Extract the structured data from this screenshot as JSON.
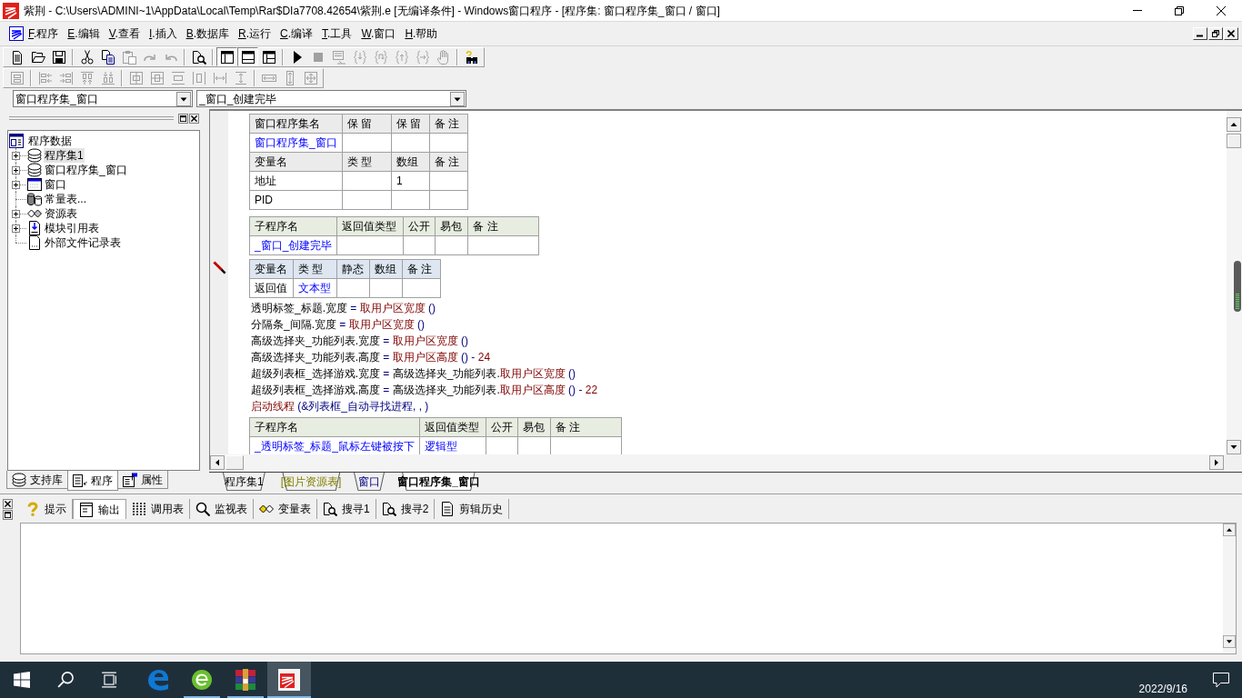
{
  "window": {
    "title": "紫荆 - C:\\Users\\ADMINI~1\\AppData\\Local\\Temp\\Rar$DIa7708.42654\\紫荆.e [无编译条件] - Windows窗口程序 - [程序集: 窗口程序集_窗口 / 窗口]"
  },
  "menu": [
    "F.程序",
    "E.编辑",
    "V.查看",
    "I.插入",
    "B.数据库",
    "R.运行",
    "C.编译",
    "T.工具",
    "W.窗口",
    "H.帮助"
  ],
  "toolbars": [
    {
      "groups": [
        [
          {
            "kind": "new",
            "disabled": false,
            "pressed": false
          },
          {
            "kind": "open",
            "disabled": false,
            "pressed": false
          },
          {
            "kind": "save",
            "disabled": false,
            "pressed": false
          }
        ],
        [
          {
            "kind": "cut",
            "disabled": false,
            "pressed": false
          },
          {
            "kind": "copy",
            "disabled": false,
            "pressed": false
          },
          {
            "kind": "paste",
            "disabled": true,
            "pressed": false
          },
          {
            "kind": "redo",
            "disabled": true,
            "pressed": false
          },
          {
            "kind": "undo",
            "disabled": true,
            "pressed": false
          }
        ],
        [
          {
            "kind": "find",
            "disabled": false,
            "pressed": false
          }
        ],
        [
          {
            "kind": "layout-left",
            "disabled": false,
            "pressed": true
          },
          {
            "kind": "layout-bottom",
            "disabled": false,
            "pressed": true
          },
          {
            "kind": "layout-grid",
            "disabled": false,
            "pressed": false
          }
        ],
        [
          {
            "kind": "run",
            "disabled": false,
            "pressed": false
          },
          {
            "kind": "stop",
            "disabled": true,
            "pressed": false
          },
          {
            "kind": "debug-window",
            "disabled": true,
            "pressed": false
          },
          {
            "kind": "step-into",
            "disabled": true,
            "pressed": false
          },
          {
            "kind": "step-over",
            "disabled": true,
            "pressed": false
          },
          {
            "kind": "step-out",
            "disabled": true,
            "pressed": false
          },
          {
            "kind": "run-to",
            "disabled": true,
            "pressed": false
          },
          {
            "kind": "hand",
            "disabled": true,
            "pressed": false
          }
        ],
        [
          {
            "kind": "help-search",
            "disabled": false,
            "pressed": false
          }
        ]
      ]
    },
    {
      "groups": [
        [
          {
            "kind": "form",
            "disabled": true,
            "pressed": false
          }
        ],
        [
          {
            "kind": "align-left",
            "disabled": true,
            "pressed": false
          },
          {
            "kind": "align-right",
            "disabled": true,
            "pressed": false
          },
          {
            "kind": "align-top",
            "disabled": true,
            "pressed": false
          },
          {
            "kind": "align-bottom",
            "disabled": true,
            "pressed": false
          }
        ],
        [
          {
            "kind": "center-horizontal",
            "disabled": true,
            "pressed": false
          },
          {
            "kind": "center-vertical",
            "disabled": true,
            "pressed": false
          },
          {
            "kind": "space-vertical",
            "disabled": true,
            "pressed": false
          },
          {
            "kind": "space-horizontal",
            "disabled": true,
            "pressed": false
          },
          {
            "kind": "spread-horizontal",
            "disabled": true,
            "pressed": false
          },
          {
            "kind": "spread-vertical",
            "disabled": true,
            "pressed": false
          }
        ],
        [
          {
            "kind": "same-width",
            "disabled": true,
            "pressed": false
          },
          {
            "kind": "same-height",
            "disabled": true,
            "pressed": false
          },
          {
            "kind": "same-size",
            "disabled": true,
            "pressed": false
          }
        ]
      ]
    }
  ],
  "selectors": [
    {
      "value": "窗口程序集_窗口"
    },
    {
      "value": "_窗口_创建完毕"
    }
  ],
  "project_panel": {
    "tree": {
      "label": "程序数据",
      "kind": "root",
      "selected": false,
      "children": [
        {
          "label": "程序集1",
          "kind": "assembly",
          "selected": true,
          "collapsed": true
        },
        {
          "label": "窗口程序集_窗口",
          "kind": "assembly",
          "selected": false,
          "collapsed": true
        },
        {
          "label": "窗口",
          "kind": "window",
          "selected": false,
          "collapsed": true
        },
        {
          "label": "常量表...",
          "kind": "constants",
          "selected": false,
          "collapsed": false
        },
        {
          "label": "资源表",
          "kind": "resources",
          "selected": false,
          "collapsed": true
        },
        {
          "label": "模块引用表",
          "kind": "modules",
          "selected": false,
          "collapsed": true
        },
        {
          "label": "外部文件记录表",
          "kind": "file",
          "selected": false,
          "collapsed": false
        }
      ]
    },
    "tabs": [
      {
        "label": "支持库",
        "kind": "library",
        "selected": false
      },
      {
        "label": "程序",
        "kind": "program",
        "selected": true
      },
      {
        "label": "属性",
        "kind": "properties",
        "selected": false
      }
    ]
  },
  "editor": {
    "blocks": [
      {
        "kind": "assembly-table",
        "current": false,
        "rows": [
          {
            "header": true,
            "cells": [
              "窗口程序集名",
              "保 留",
              "保 留",
              "备 注"
            ]
          },
          {
            "header": false,
            "cells": [
              {
                "text": "窗口程序集_窗口",
                "link": true
              },
              null,
              null,
              null
            ]
          },
          {
            "header": true,
            "cells": [
              "变量名",
              "类 型",
              "数组",
              "备 注"
            ]
          },
          {
            "header": false,
            "cells": [
              {
                "text": "地址",
                "link": false
              },
              null,
              {
                "text": "1",
                "link": false
              },
              null
            ]
          },
          {
            "header": false,
            "cells": [
              {
                "text": "PID",
                "link": false
              },
              null,
              null,
              null
            ]
          }
        ]
      },
      {
        "kind": "subroutine-table",
        "current": false,
        "rows": [
          {
            "header": true,
            "cells": [
              "子程序名",
              "返回值类型",
              "公开",
              "易包",
              "备 注"
            ]
          },
          {
            "header": false,
            "cells": [
              {
                "text": "_窗口_创建完毕",
                "link": true
              },
              null,
              null,
              null,
              null
            ]
          }
        ]
      },
      {
        "kind": "locals-table",
        "current": true,
        "rows": [
          {
            "header": true,
            "cells": [
              "变量名",
              "类 型",
              "静态",
              "数组",
              "备 注"
            ]
          },
          {
            "header": false,
            "cells": [
              {
                "text": "返回值",
                "link": false
              },
              {
                "text": "文本型",
                "link": true
              },
              null,
              null,
              null
            ]
          }
        ]
      },
      {
        "kind": "code",
        "current": false,
        "lines": [
          {
            "tokens": [
              {
                "text": "透明标签_标题.宽度",
                "kind": "plain"
              },
              {
                "text": " = ",
                "kind": "operator"
              },
              {
                "text": "取用户区宽度",
                "kind": "call"
              },
              {
                "text": " ()",
                "kind": "operator"
              }
            ]
          },
          {
            "tokens": [
              {
                "text": "分隔条_间隔.宽度",
                "kind": "plain"
              },
              {
                "text": " = ",
                "kind": "operator"
              },
              {
                "text": "取用户区宽度",
                "kind": "call"
              },
              {
                "text": " ()",
                "kind": "operator"
              }
            ]
          },
          {
            "tokens": [
              {
                "text": "高级选择夹_功能列表.宽度",
                "kind": "plain"
              },
              {
                "text": " = ",
                "kind": "operator"
              },
              {
                "text": "取用户区宽度",
                "kind": "call"
              },
              {
                "text": " ()",
                "kind": "operator"
              }
            ]
          },
          {
            "tokens": [
              {
                "text": "高级选择夹_功能列表.高度",
                "kind": "plain"
              },
              {
                "text": " = ",
                "kind": "operator"
              },
              {
                "text": "取用户区高度",
                "kind": "call"
              },
              {
                "text": " () - ",
                "kind": "operator"
              },
              {
                "text": "24",
                "kind": "number"
              }
            ]
          },
          {
            "tokens": [
              {
                "text": "超级列表框_选择游戏.宽度",
                "kind": "plain"
              },
              {
                "text": " = ",
                "kind": "operator"
              },
              {
                "text": "高级选择夹_功能列表.",
                "kind": "plain"
              },
              {
                "text": "取用户区宽度",
                "kind": "call"
              },
              {
                "text": " ()",
                "kind": "operator"
              }
            ]
          },
          {
            "tokens": [
              {
                "text": "超级列表框_选择游戏.高度",
                "kind": "plain"
              },
              {
                "text": " = ",
                "kind": "operator"
              },
              {
                "text": "高级选择夹_功能列表.",
                "kind": "plain"
              },
              {
                "text": "取用户区高度",
                "kind": "call"
              },
              {
                "text": " () - ",
                "kind": "operator"
              },
              {
                "text": "22",
                "kind": "number"
              }
            ]
          },
          {
            "tokens": [
              {
                "text": "启动线程",
                "kind": "call"
              },
              {
                "text": " (&列表框_自动寻找进程, , )",
                "kind": "operator"
              }
            ]
          }
        ]
      },
      {
        "kind": "subroutine-table",
        "current": false,
        "rows": [
          {
            "header": true,
            "cells": [
              "子程序名",
              "返回值类型",
              "公开",
              "易包",
              "备 注"
            ]
          },
          {
            "header": false,
            "cells": [
              {
                "text": "_透明标签_标题_鼠标左键被按下",
                "link": true
              },
              {
                "text": "逻辑型",
                "link": true
              },
              null,
              null,
              null
            ]
          }
        ]
      }
    ],
    "tabs": [
      {
        "label": "程序集1",
        "kind": "assembly",
        "selected": false
      },
      {
        "label": "[图片资源表]",
        "kind": "resource",
        "selected": false
      },
      {
        "label": "窗口",
        "kind": "window",
        "selected": false
      },
      {
        "label": "窗口程序集_窗口",
        "kind": "assembly",
        "selected": true
      }
    ]
  },
  "output_panel": {
    "tabs": [
      {
        "label": "提示",
        "kind": "hint",
        "selected": false
      },
      {
        "label": "输出",
        "kind": "output",
        "selected": true
      },
      {
        "label": "调用表",
        "kind": "calls",
        "selected": false
      },
      {
        "label": "监视表",
        "kind": "watch",
        "selected": false
      },
      {
        "label": "变量表",
        "kind": "variables",
        "selected": false
      },
      {
        "label": "搜寻1",
        "kind": "search",
        "selected": false
      },
      {
        "label": "搜寻2",
        "kind": "search",
        "selected": false
      },
      {
        "label": "剪辑历史",
        "kind": "clipboard",
        "selected": false
      }
    ]
  },
  "taskbar": {
    "apps": [
      {
        "kind": "edge",
        "running": false,
        "active": false
      },
      {
        "kind": "green-browser",
        "running": true,
        "active": false
      },
      {
        "kind": "archiver",
        "running": true,
        "active": false
      },
      {
        "kind": "ide",
        "running": true,
        "active": true
      }
    ],
    "date": "2022/9/16"
  }
}
